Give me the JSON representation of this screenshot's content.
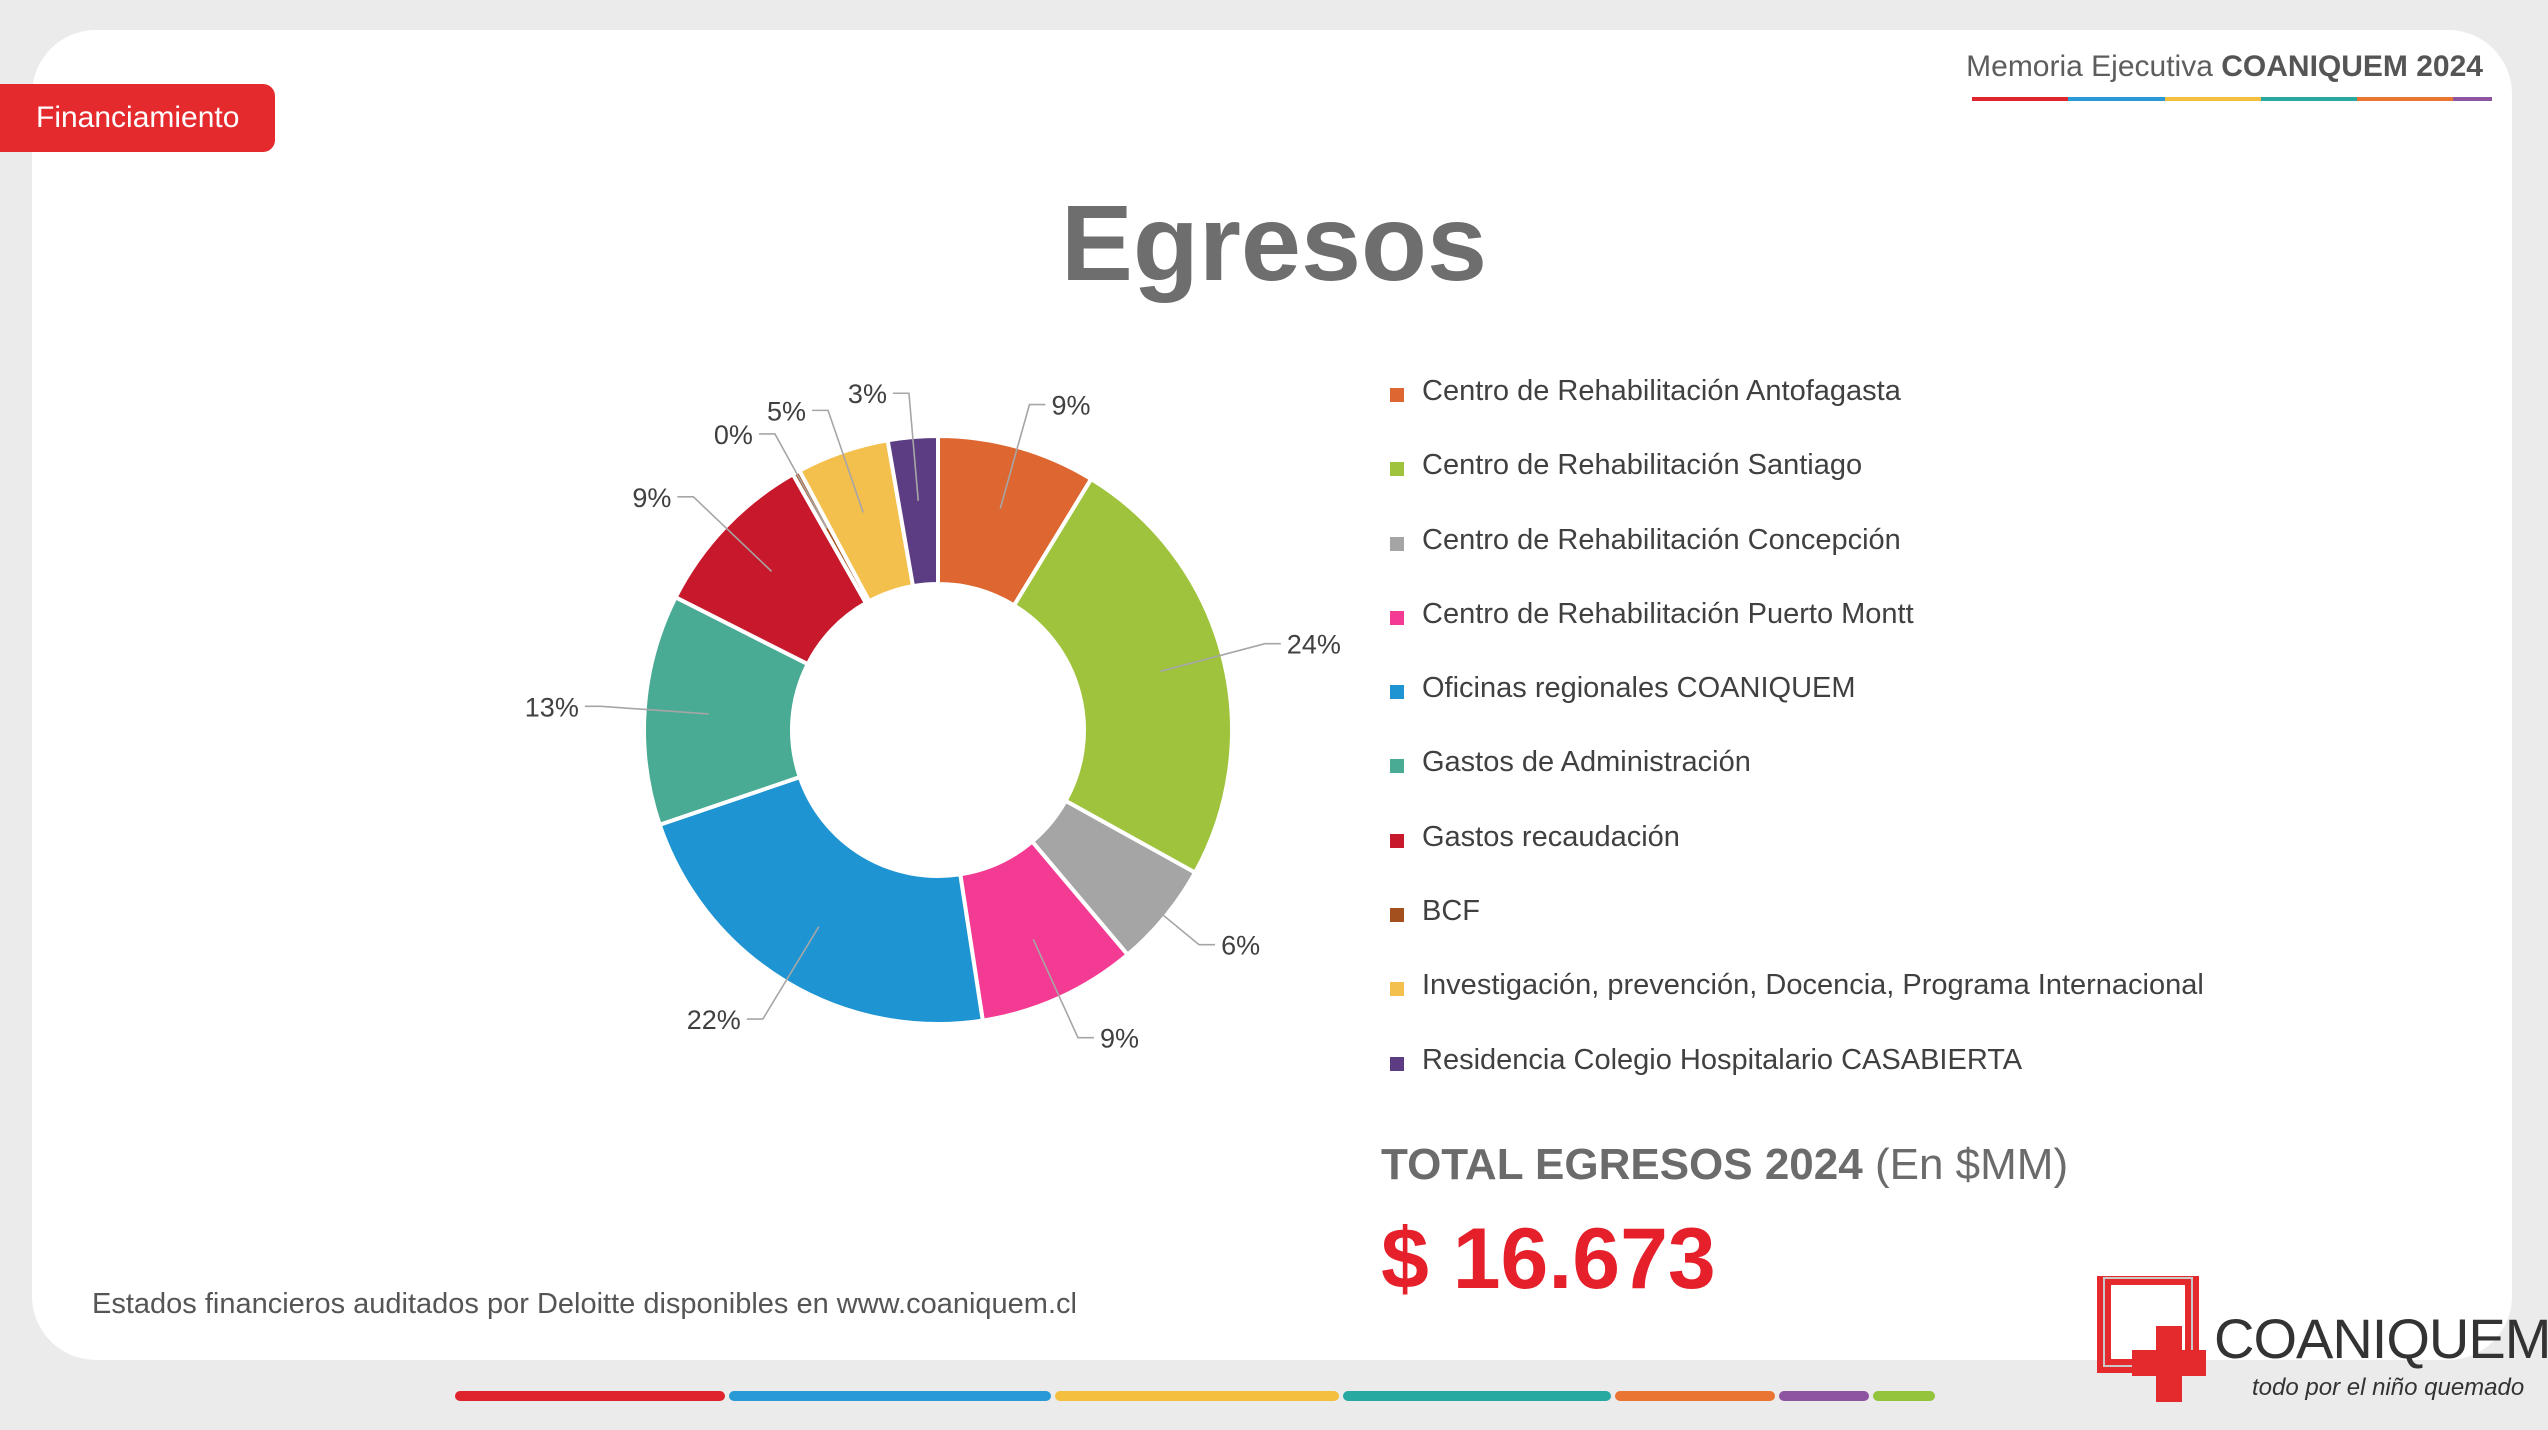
{
  "section_tag": "Financiamiento",
  "header": {
    "prefix": "Memoria Ejecutiva",
    "brand": "COANIQUEM 2024"
  },
  "title": "Egresos",
  "chart_data": {
    "type": "pie",
    "donut": true,
    "legend_position": "right",
    "slices": [
      {
        "name": "Centro de Rehabilitación Antofagasta",
        "label": "9%",
        "value": 8.6,
        "color": "#dd6631"
      },
      {
        "name": "Centro de Rehabilitación Santiago",
        "label": "24%",
        "value": 24.0,
        "color": "#9fc33d"
      },
      {
        "name": "Centro de Rehabilitación Concepción",
        "label": "6%",
        "value": 5.7,
        "color": "#a5a5a5"
      },
      {
        "name": "Centro de Rehabilitación Puerto Montt",
        "label": "9%",
        "value": 8.6,
        "color": "#f43b93"
      },
      {
        "name": "Oficinas regionales COANIQUEM",
        "label": "22%",
        "value": 21.9,
        "color": "#1e94d2"
      },
      {
        "name": "Gastos de Administración",
        "label": "13%",
        "value": 12.5,
        "color": "#4aab94"
      },
      {
        "name": "Gastos recaudación",
        "label": "9%",
        "value": 9.2,
        "color": "#c8182b"
      },
      {
        "name": "BCF",
        "label": "0%",
        "value": 0.4,
        "color": "#a4501e"
      },
      {
        "name": "Investigación, prevención, Docencia, Programa Internacional",
        "label": "5%",
        "value": 5.0,
        "color": "#f4c04d"
      },
      {
        "name": "Residencia Colegio Hospitalario CASABIERTA",
        "label": "3%",
        "value": 2.7,
        "color": "#5c3c82"
      }
    ]
  },
  "total": {
    "label": "TOTAL EGRESOS 2024",
    "unit": "(En $MM)",
    "value": "$ 16.673"
  },
  "footer_note": "Estados financieros auditados por Deloitte disponibles en www.coaniquem.cl",
  "logo": {
    "name": "COANIQUEM",
    "tagline": "todo por el niño quemado"
  },
  "colors": {
    "accent_red": "#e52a2e",
    "bar_segments": [
      "#e0242e",
      "#2a9ad6",
      "#f4be3f",
      "#27a9a1",
      "#ea7532",
      "#8d55a1",
      "#94c43b"
    ]
  }
}
